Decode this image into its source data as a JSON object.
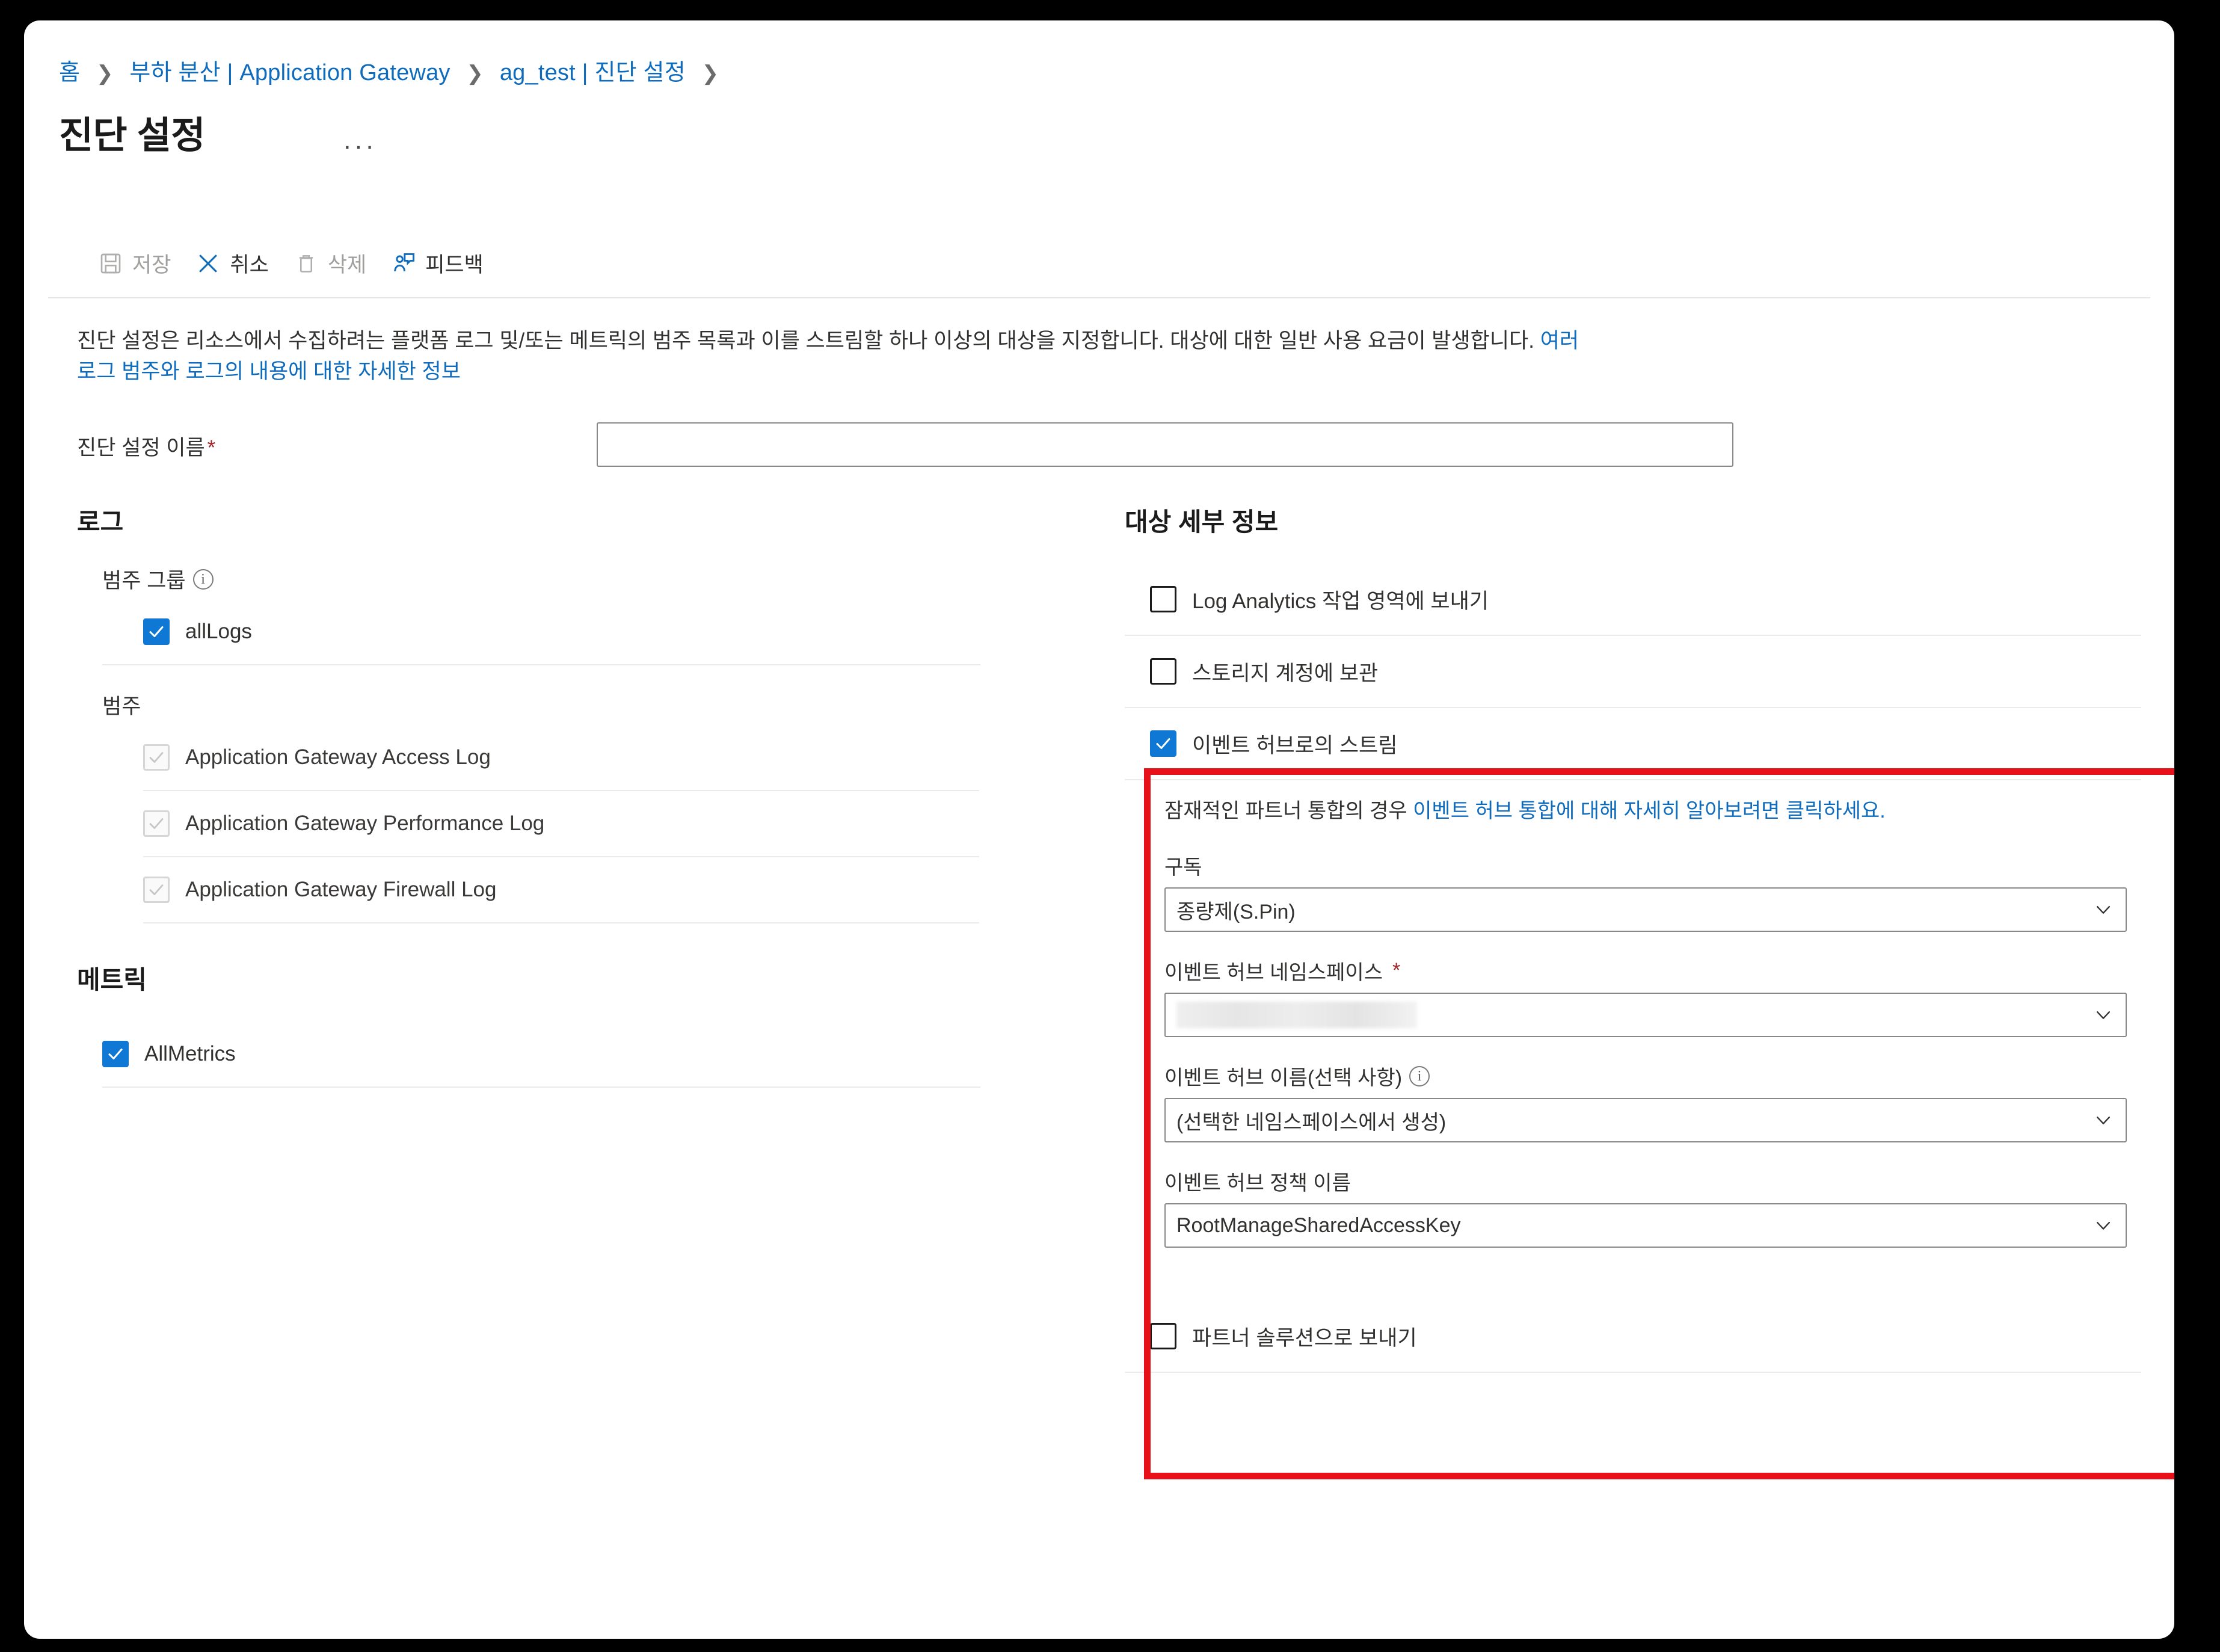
{
  "breadcrumb": {
    "items": [
      {
        "label": "홈"
      },
      {
        "label": "부하 분산 | Application Gateway"
      },
      {
        "label": "ag_test | 진단 설정"
      }
    ],
    "separator": "❯"
  },
  "header": {
    "title": "진단 설정",
    "ellipsis": "···"
  },
  "toolbar": {
    "save_label": "저장",
    "cancel_label": "취소",
    "delete_label": "삭제",
    "feedback_label": "피드백"
  },
  "description": {
    "text_part1": "진단 설정은 리소스에서 수집하려는 플랫폼 로그 및/또는 메트릭의 범주 목록과 이를 스트림할 하나 이상의 대상을 지정합니다. 대상에 대한 일반 사용 요금이 발생합니다. ",
    "link_text": "여러 로그 범주와 로그의 내용에 대한 자세한 정보"
  },
  "name_field": {
    "label": "진단 설정 이름",
    "required_mark": "*",
    "value": "",
    "placeholder": ""
  },
  "logs_section": {
    "heading": "로그",
    "category_group_label": "범주 그룹",
    "category_group_items": [
      {
        "label": "allLogs",
        "checked": true,
        "disabled": false
      }
    ],
    "category_label": "범주",
    "category_items": [
      {
        "label": "Application Gateway Access Log",
        "checked": true,
        "disabled": true
      },
      {
        "label": "Application Gateway Performance Log",
        "checked": true,
        "disabled": true
      },
      {
        "label": "Application Gateway Firewall Log",
        "checked": true,
        "disabled": true
      }
    ]
  },
  "metrics_section": {
    "heading": "메트릭",
    "items": [
      {
        "label": "AllMetrics",
        "checked": true,
        "disabled": false
      }
    ]
  },
  "destination_section": {
    "heading": "대상 세부 정보",
    "log_analytics_label": "Log Analytics 작업 영역에 보내기",
    "storage_label": "스토리지 계정에 보관",
    "event_hub_label": "이벤트 허브로의 스트림",
    "partner_label": "파트너 솔루션으로 보내기"
  },
  "event_hub": {
    "note_prefix": "잠재적인 파트너 통합의 경우 ",
    "note_link": "이벤트 허브 통합에 대해 자세히 알아보려면 클릭하세요.",
    "subscription_label": "구독",
    "subscription_value": "종량제(S.Pin)",
    "namespace_label": "이벤트 허브 네임스페이스",
    "namespace_required": "*",
    "namespace_value": "",
    "hub_name_label": "이벤트 허브 이름(선택 사항)",
    "hub_name_value": "(선택한 네임스페이스에서 생성)",
    "policy_label": "이벤트 허브 정책 이름",
    "policy_value": "RootManageSharedAccessKey"
  },
  "colors": {
    "accent": "#0f6cbd",
    "checkbox_on": "#0f77d4",
    "highlight_red": "#e8111a",
    "required_star": "#a4262c"
  },
  "icons": {
    "save": "save-icon",
    "cancel": "close-x-icon",
    "delete": "trash-icon",
    "feedback": "feedback-person-icon",
    "info": "info-circle-icon",
    "chevron": "chevron-down-icon"
  }
}
